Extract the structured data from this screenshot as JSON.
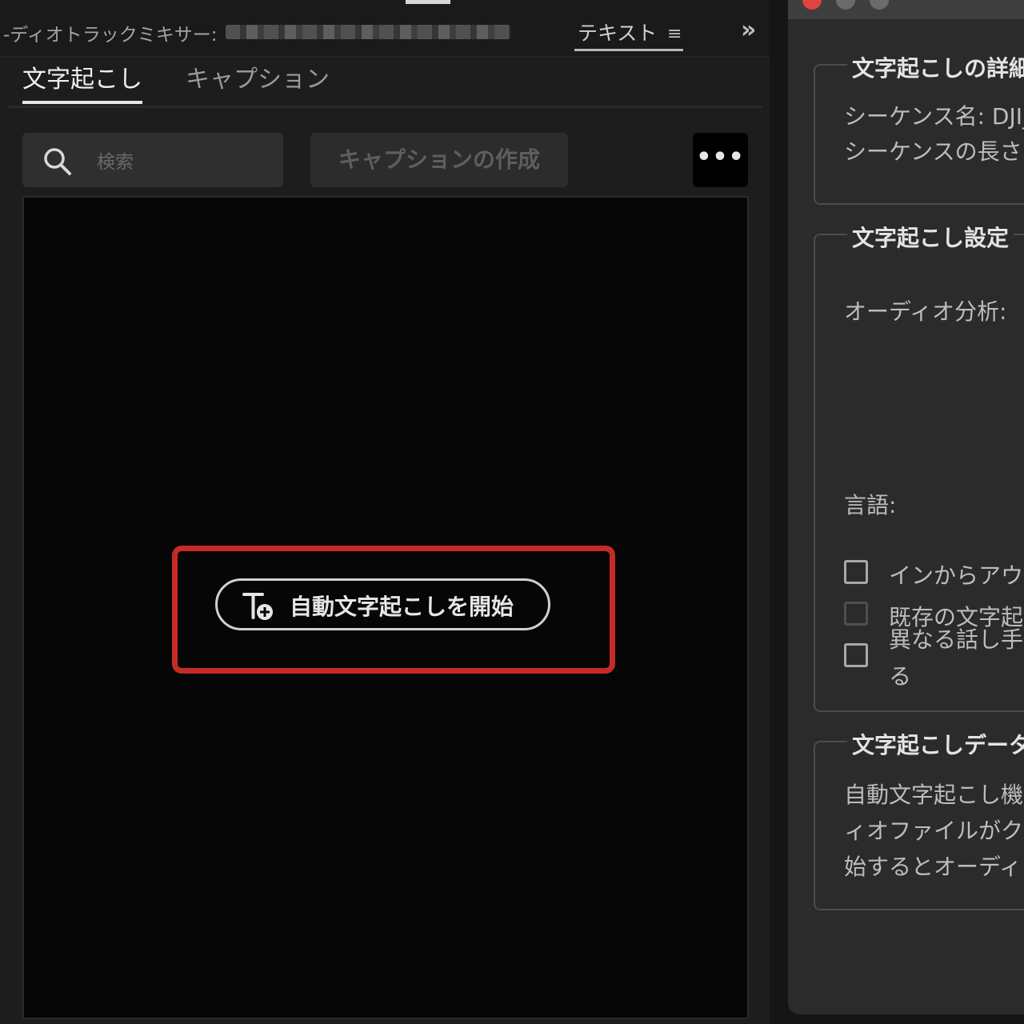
{
  "panel": {
    "mixer_tab_label": "-ディオトラックミキサー:",
    "text_tab_label": "テキスト",
    "text_tab_menu_icon": "≡",
    "overflow_icon": "»"
  },
  "tabs": [
    {
      "label": "文字起こし",
      "active": true
    },
    {
      "label": "キャプション",
      "active": false
    }
  ],
  "toolbar": {
    "search_placeholder": "検索",
    "create_captions_label": "キャプションの作成",
    "more_label": "•••"
  },
  "main": {
    "start_transcription_label": "自動文字起こしを開始",
    "highlight_color": "#c42b25"
  },
  "dialog": {
    "details_title": "文字起こしの詳細",
    "sequence_name_label": "シーケンス名: DJI_",
    "sequence_length_label": "シーケンスの長さ",
    "settings_title": "文字起こし設定",
    "audio_analysis_label": "オーディオ分析:",
    "language_label": "言語:",
    "in_to_out_label": "インからアウ",
    "existing_transcript_label_1": "既存の文字起",
    "existing_transcript_label_2": "異なる話し手",
    "existing_transcript_label_3": "る",
    "data_title": "文字起こしデータ",
    "data_line_1": "自動文字起こし機",
    "data_line_2": "ィオファイルがク",
    "data_line_3": "始するとオーディ"
  },
  "colors": {
    "panel_bg": "#1d1d1d",
    "transcript_bg": "#060606",
    "dialog_bg": "#2b2b2b",
    "close_light": "#e0443e"
  }
}
